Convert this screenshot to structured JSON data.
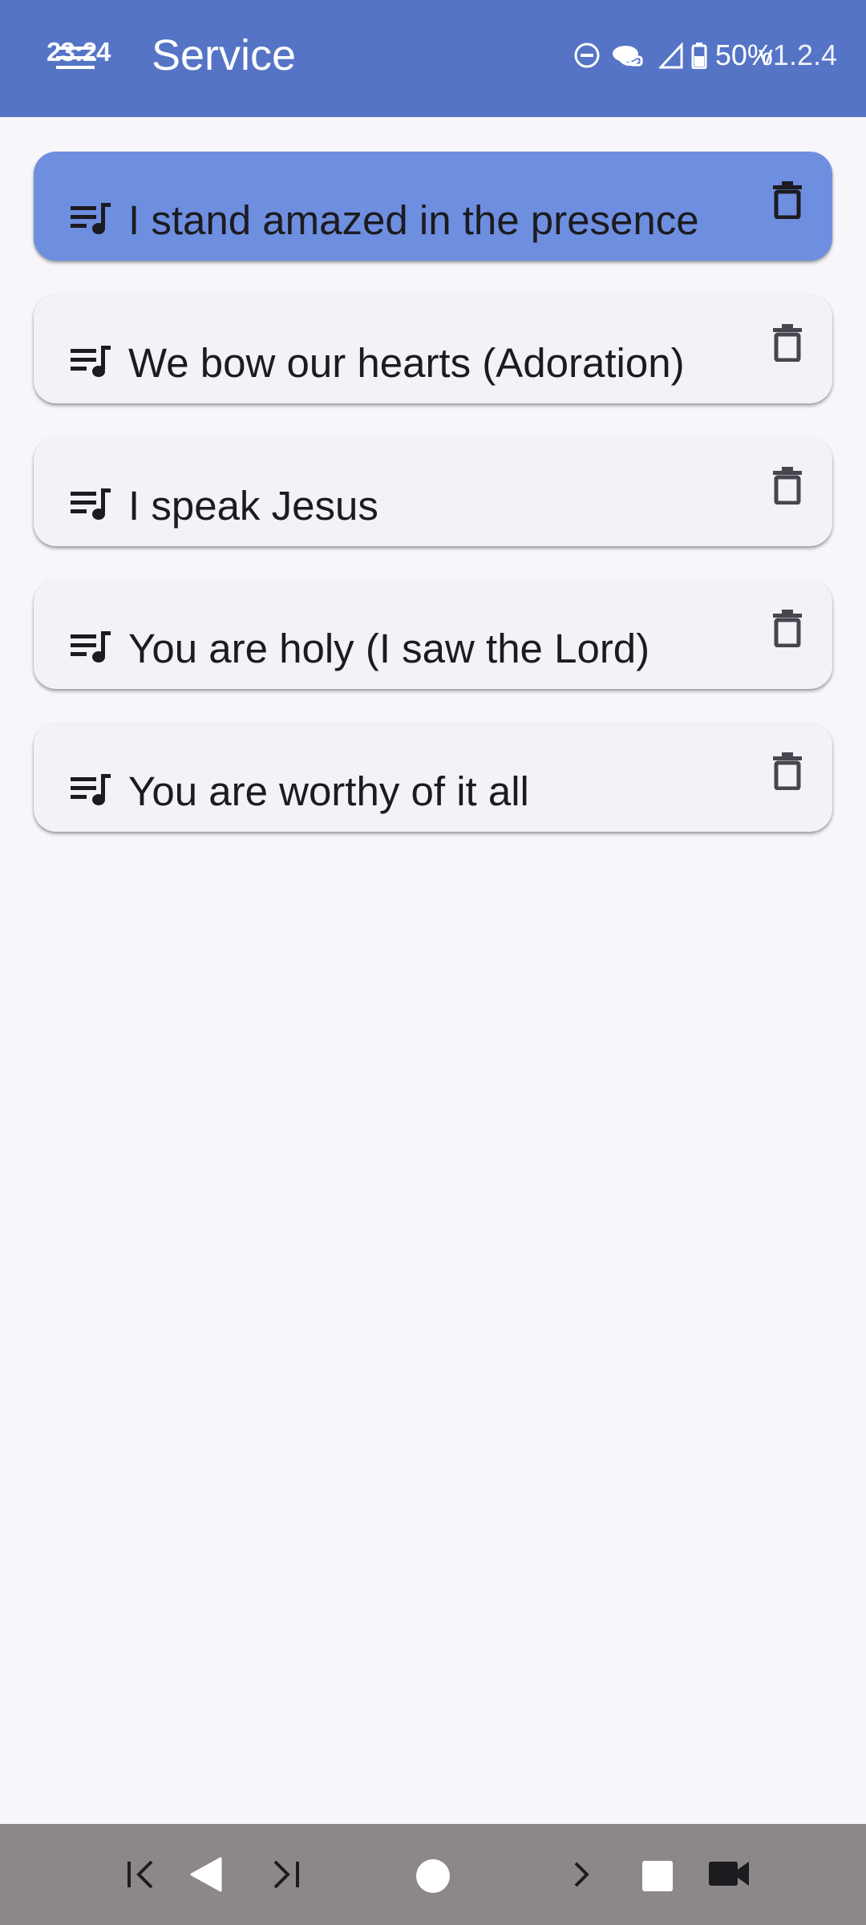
{
  "status_bar": {
    "time": "23:24",
    "battery": "50%",
    "version": "v1.2.4"
  },
  "app_bar": {
    "title": "Service",
    "background_color": "#5574c5"
  },
  "songs": [
    {
      "title": "I stand amazed in the presence",
      "selected": true
    },
    {
      "title": "We bow our hearts (Adoration)",
      "selected": false
    },
    {
      "title": "I speak Jesus",
      "selected": false
    },
    {
      "title": "You are holy (I saw the Lord)",
      "selected": false
    },
    {
      "title": "You are worthy of it all",
      "selected": false
    }
  ],
  "icons": {
    "song": "queue-music-icon",
    "delete": "trash-icon",
    "menu": "menu-icon"
  },
  "colors": {
    "selected_card": "#6e8ee0",
    "card": "#f4f1f7",
    "background": "#f8f6fb",
    "bottom_bar": "#8d8888"
  },
  "bottom_bar": {
    "buttons": [
      "skip-previous-icon",
      "back-icon",
      "skip-next-icon",
      "home-icon",
      "forward-icon",
      "stop-icon",
      "video-camera-icon"
    ]
  }
}
